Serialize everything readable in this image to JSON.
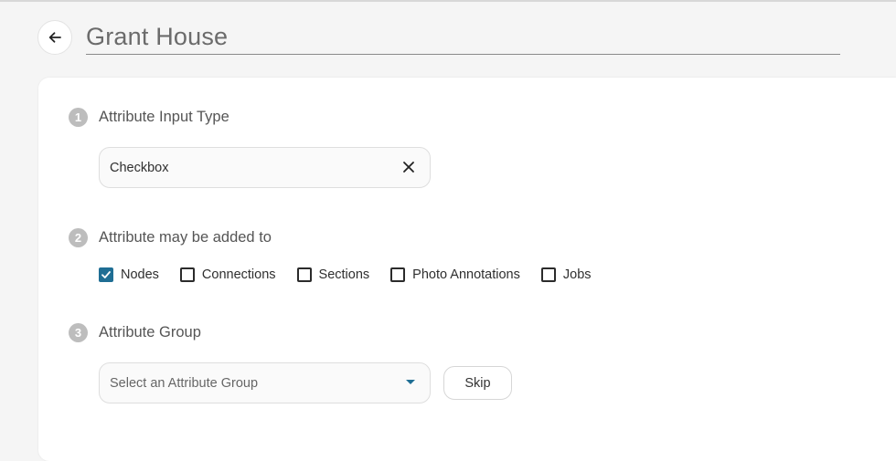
{
  "header": {
    "title": "Grant House",
    "back_icon": "arrow-left-icon"
  },
  "steps": [
    {
      "number": "1",
      "label": "Attribute Input Type"
    },
    {
      "number": "2",
      "label": "Attribute may be added to"
    },
    {
      "number": "3",
      "label": "Attribute Group"
    }
  ],
  "input_type": {
    "value": "Checkbox",
    "clear_icon": "close-icon"
  },
  "targets": [
    {
      "label": "Nodes",
      "checked": true
    },
    {
      "label": "Connections",
      "checked": false
    },
    {
      "label": "Sections",
      "checked": false
    },
    {
      "label": "Photo Annotations",
      "checked": false
    },
    {
      "label": "Jobs",
      "checked": false
    }
  ],
  "group": {
    "placeholder": "Select an Attribute Group",
    "arrow_icon": "caret-down-icon",
    "skip_label": "Skip"
  },
  "colors": {
    "accent": "#1f6e94",
    "step_badge": "#bdbdbd"
  }
}
